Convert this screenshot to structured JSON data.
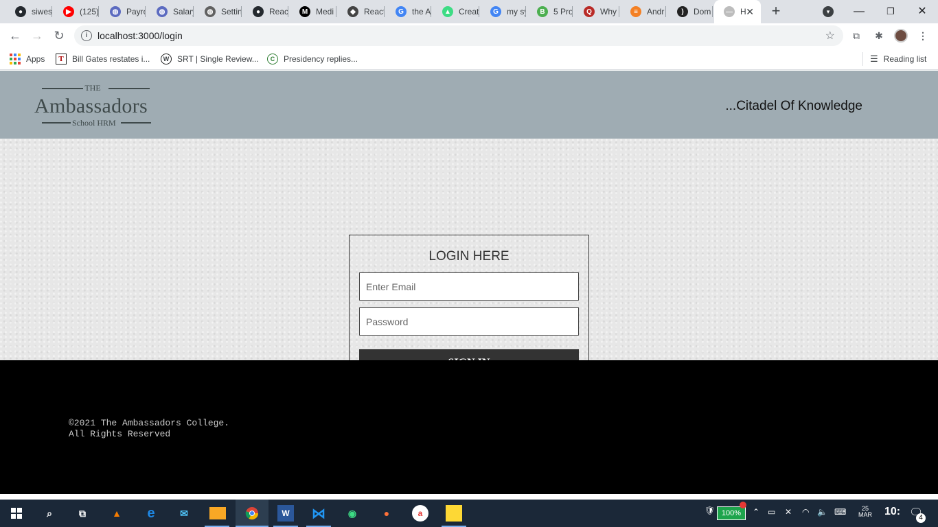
{
  "browser": {
    "tabs": [
      {
        "label": "siwes",
        "icon": "github-icon"
      },
      {
        "label": "(125)",
        "icon": "youtube-icon"
      },
      {
        "label": "Payro",
        "icon": "globe-icon"
      },
      {
        "label": "Salary",
        "icon": "globe-icon"
      },
      {
        "label": "Settin",
        "icon": "settings-globe-icon"
      },
      {
        "label": "React",
        "icon": "github-icon"
      },
      {
        "label": "Medi",
        "icon": "medium-icon"
      },
      {
        "label": "React",
        "icon": "react-diamond-icon"
      },
      {
        "label": "the A",
        "icon": "google-icon"
      },
      {
        "label": "Creat",
        "icon": "android-icon"
      },
      {
        "label": "my sy",
        "icon": "google-icon"
      },
      {
        "label": "5 Pro",
        "icon": "bitcoin-icon"
      },
      {
        "label": "Why",
        "icon": "quora-icon"
      },
      {
        "label": "Andr",
        "icon": "stackoverflow-icon"
      },
      {
        "label": "Dom",
        "icon": "rss-icon"
      },
      {
        "label": "H",
        "icon": "page-icon",
        "active": true
      }
    ],
    "new_tab": "+",
    "window_controls": {
      "minimize": "—",
      "restore": "❐",
      "close": "✕"
    },
    "url": "localhost:3000/login",
    "bookmarks": [
      {
        "label": "Apps",
        "icon": "apps-grid-icon"
      },
      {
        "label": "Bill Gates restates i...",
        "icon": "t-logo-icon"
      },
      {
        "label": "SRT | Single Review...",
        "icon": "w-logo-icon"
      },
      {
        "label": "Presidency replies...",
        "icon": "c-logo-icon"
      }
    ],
    "reading_list": "Reading list"
  },
  "site": {
    "logo": {
      "the": "THE",
      "name": "Ambassadors",
      "sub": "School HRM"
    },
    "tagline": "...Citadel Of Knowledge",
    "login": {
      "title": "LOGIN HERE",
      "email_placeholder": "Enter Email",
      "password_placeholder": "Password",
      "submit_label": "SIGN IN"
    },
    "footer": {
      "line1": "©2021 The Ambassadors College.",
      "line2": "All Rights Reserved"
    }
  },
  "taskbar": {
    "battery": "100%",
    "date": "25\nMAR",
    "time": "10:",
    "notifications": "4"
  },
  "colors": {
    "header_bg": "#9facb3",
    "button_bg": "#333333",
    "footer_bg": "#000000",
    "taskbar_bg": "#1b2838"
  }
}
